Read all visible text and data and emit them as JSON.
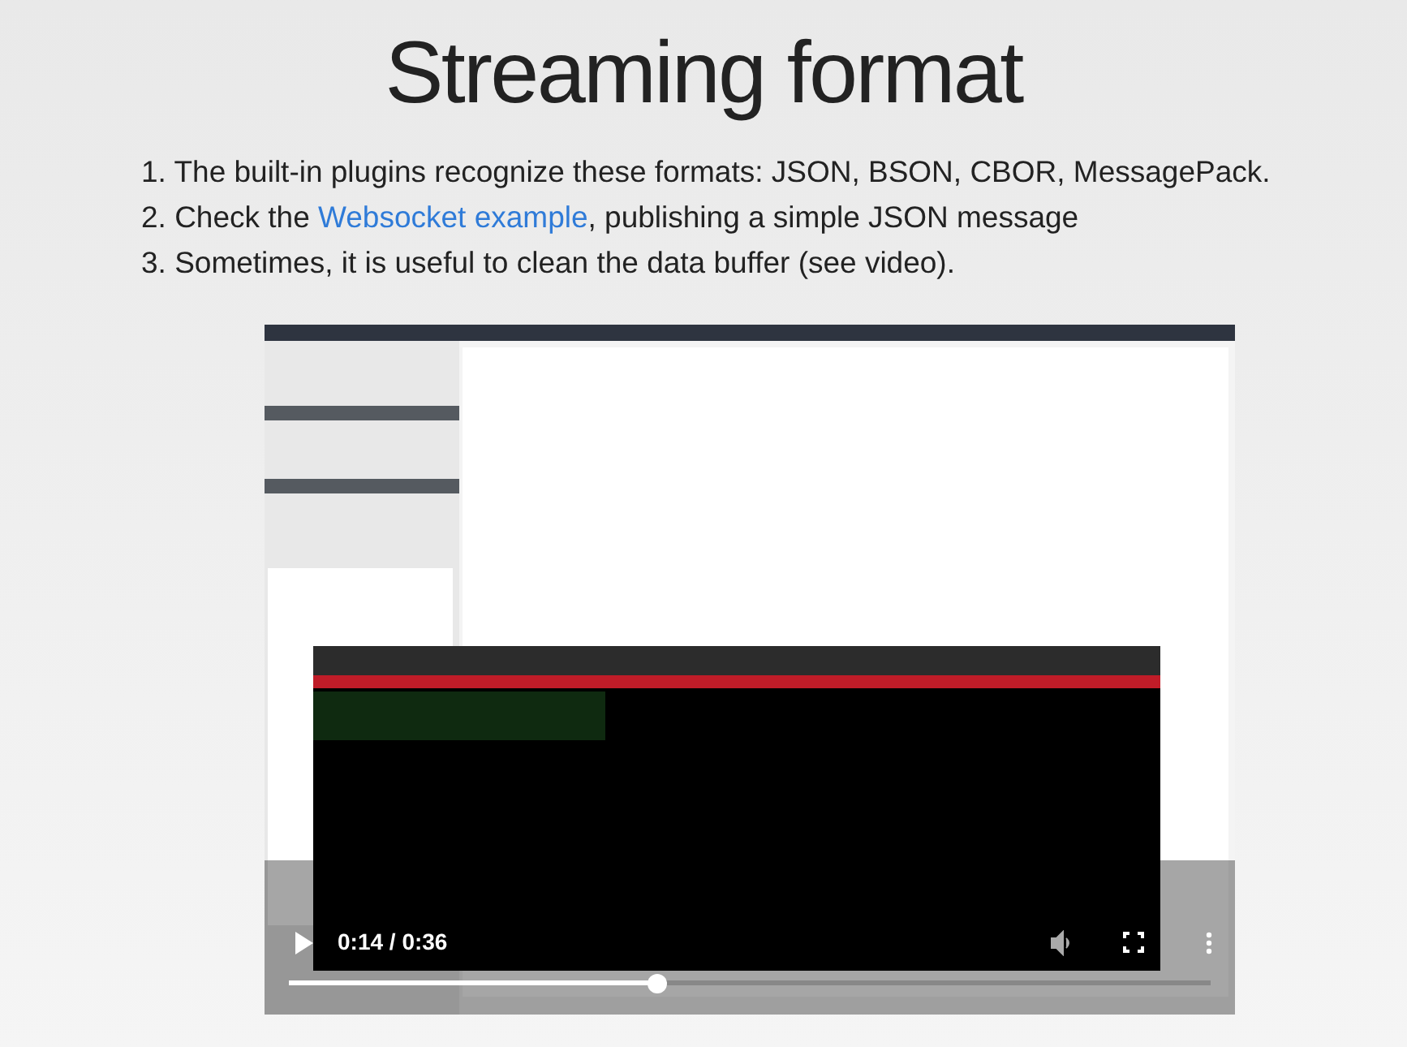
{
  "title": "Streaming format",
  "items": [
    {
      "text": "1. The built-in plugins recognize these formats: JSON, BSON, CBOR, MessagePack."
    },
    {
      "text": "2. Check the ",
      "link": "Websocket example",
      "after": ", publishing a simple JSON message"
    },
    {
      "text": "3. Sometimes, it is useful to clean the data buffer (see video)."
    }
  ],
  "video": {
    "kind": "picture",
    "playing": false,
    "time": "0:14 / 0:36",
    "level": 0.4
  }
}
